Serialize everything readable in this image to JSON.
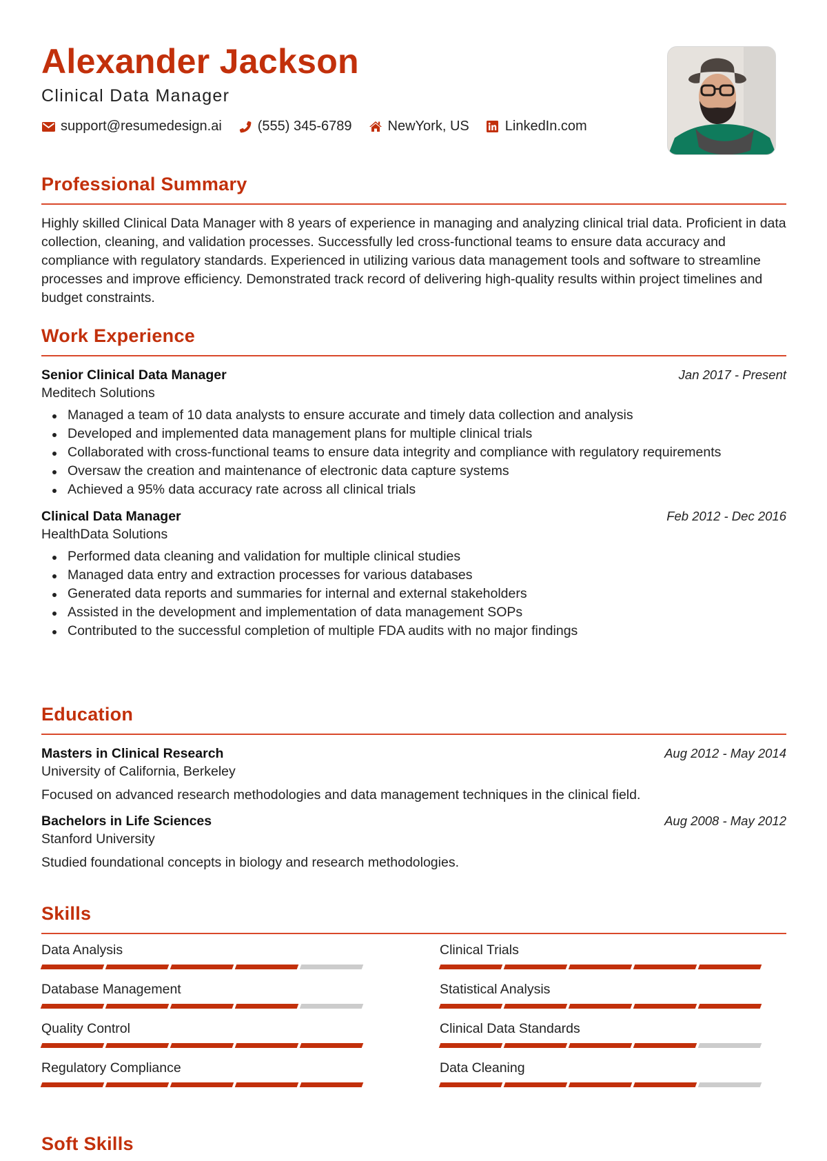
{
  "header": {
    "name": "Alexander Jackson",
    "title": "Clinical Data Manager",
    "contacts": [
      {
        "icon": "envelope-icon",
        "text": "support@resumedesign.ai"
      },
      {
        "icon": "phone-icon",
        "text": "(555) 345-6789"
      },
      {
        "icon": "home-icon",
        "text": "NewYork, US"
      },
      {
        "icon": "linkedin-icon",
        "text": "LinkedIn.com"
      }
    ],
    "photo_alt": "Profile photo"
  },
  "accent_color": "#c2300b",
  "summary": {
    "heading": "Professional Summary",
    "text": "Highly skilled Clinical Data Manager with 8 years of experience in managing and analyzing clinical trial data. Proficient in data collection, cleaning, and validation processes. Successfully led cross-functional teams to ensure data accuracy and compliance with regulatory standards. Experienced in utilizing various data management tools and software to streamline processes and improve efficiency. Demonstrated track record of delivering high-quality results within project timelines and budget constraints."
  },
  "experience": {
    "heading": "Work Experience",
    "jobs": [
      {
        "title": "Senior Clinical Data Manager",
        "company": "Meditech Solutions",
        "dates": "Jan 2017 - Present",
        "bullets": [
          "Managed a team of 10 data analysts to ensure accurate and timely data collection and analysis",
          "Developed and implemented data management plans for multiple clinical trials",
          "Collaborated with cross-functional teams to ensure data integrity and compliance with regulatory requirements",
          "Oversaw the creation and maintenance of electronic data capture systems",
          "Achieved a 95% data accuracy rate across all clinical trials"
        ]
      },
      {
        "title": "Clinical Data Manager",
        "company": "HealthData Solutions",
        "dates": "Feb 2012 - Dec 2016",
        "bullets": [
          "Performed data cleaning and validation for multiple clinical studies",
          "Managed data entry and extraction processes for various databases",
          "Generated data reports and summaries for internal and external stakeholders",
          "Assisted in the development and implementation of data management SOPs",
          "Contributed to the successful completion of multiple FDA audits with no major findings"
        ]
      }
    ]
  },
  "education": {
    "heading": "Education",
    "items": [
      {
        "degree": "Masters in Clinical Research",
        "school": "University of California, Berkeley",
        "dates": "Aug 2012 - May 2014",
        "description": "Focused on advanced research methodologies and data management techniques in the clinical field."
      },
      {
        "degree": "Bachelors in Life Sciences",
        "school": "Stanford University",
        "dates": "Aug 2008 - May 2012",
        "description": "Studied foundational concepts in biology and research methodologies."
      }
    ]
  },
  "skills": {
    "heading": "Skills",
    "max_level": 5,
    "items": [
      {
        "name": "Data Analysis",
        "level": 4
      },
      {
        "name": "Clinical Trials",
        "level": 5
      },
      {
        "name": "Database Management",
        "level": 4
      },
      {
        "name": "Statistical Analysis",
        "level": 5
      },
      {
        "name": "Quality Control",
        "level": 5
      },
      {
        "name": "Clinical Data Standards",
        "level": 4
      },
      {
        "name": "Regulatory Compliance",
        "level": 5
      },
      {
        "name": "Data Cleaning",
        "level": 4
      }
    ]
  },
  "soft_skills": {
    "heading": "Soft Skills"
  }
}
